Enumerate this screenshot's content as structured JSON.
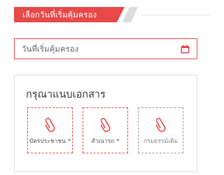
{
  "section": {
    "title": "เลือกวันที่เริ่มคุ้มครอง"
  },
  "date_field": {
    "placeholder": "วันที่เริ่มคุ้มครอง",
    "icon": "calendar-icon"
  },
  "documents": {
    "title": "กรุณาแนบเอกสาร",
    "items": [
      {
        "label": "บัตรประชาชน",
        "required_mark": "*",
        "icon": "paperclip-icon"
      },
      {
        "label": "สำเนารถ",
        "required_mark": "*",
        "icon": "paperclip-icon"
      },
      {
        "label": "กรมธรรม์เดิม",
        "required_mark": "",
        "icon": "paperclip-icon"
      }
    ]
  },
  "colors": {
    "accent": "#e84848",
    "accent_gray": "#dcdcdc",
    "border_gray": "#dedede",
    "muted_dashed": "#9a9a9a"
  }
}
